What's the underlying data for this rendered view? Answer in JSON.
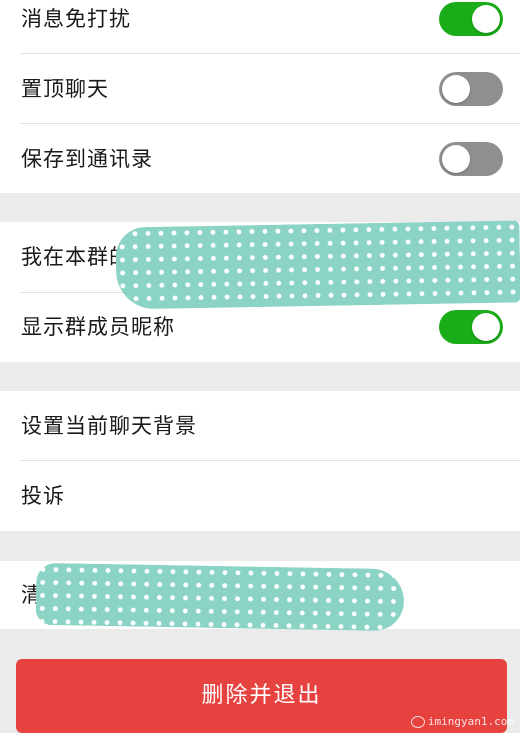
{
  "group1": {
    "mute": {
      "label": "消息免打扰",
      "enabled": true
    },
    "pin": {
      "label": "置顶聊天",
      "enabled": false
    },
    "save_contacts": {
      "label": "保存到通讯录",
      "enabled": false
    }
  },
  "group2": {
    "my_nickname": {
      "label": "我在本群的昵"
    },
    "show_nicknames": {
      "label": "显示群成员昵称",
      "enabled": true
    }
  },
  "group3": {
    "background": {
      "label": "设置当前聊天背景"
    },
    "complain": {
      "label": "投诉"
    }
  },
  "group4": {
    "clear_history": {
      "label": "清"
    }
  },
  "delete_button": {
    "label": "删除并退出",
    "color": "#e64340"
  },
  "watermark": {
    "text": "imingyan1.com"
  },
  "colors": {
    "switch_on": "#1aad19",
    "switch_off": "#8f8f8f",
    "redaction": "#8bd3c5"
  }
}
